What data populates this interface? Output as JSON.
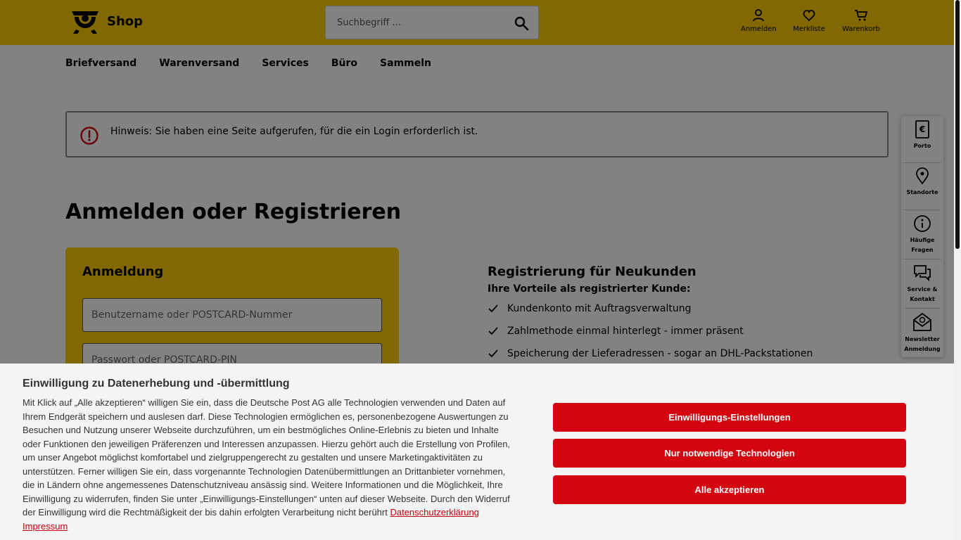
{
  "header": {
    "logo_text": "Shop",
    "search_placeholder": "Suchbegriff ...",
    "actions": [
      {
        "label": "Anmelden",
        "icon": "user-icon"
      },
      {
        "label": "Merkliste",
        "icon": "heart-icon"
      },
      {
        "label": "Warenkorb",
        "icon": "cart-icon"
      }
    ]
  },
  "nav": [
    "Briefversand",
    "Warenversand",
    "Services",
    "Büro",
    "Sammeln"
  ],
  "notice": {
    "text": "Hinweis: Sie haben eine Seite aufgerufen, für die ein Login erforderlich ist.",
    "icon": "alert-icon"
  },
  "page_title": "Anmelden oder Registrieren",
  "login": {
    "title": "Anmeldung",
    "username_placeholder": "Benutzername oder POSTCARD-Nummer",
    "password_placeholder": "Passwort oder POSTCARD-PIN"
  },
  "register": {
    "title": "Registrierung für Neukunden",
    "subtitle": "Ihre Vorteile als registrierter Kunde:",
    "benefits": [
      "Kundenkonto mit Auftragsverwaltung",
      "Zahlmethode einmal hinterlegt - immer präsent",
      "Speicherung der Lieferadressen - sogar an DHL-Packstationen"
    ]
  },
  "side_panel": [
    {
      "label1": "Porto",
      "label2": "",
      "icon": "euro-document-icon"
    },
    {
      "label1": "Standorte",
      "label2": "",
      "icon": "location-pin-icon"
    },
    {
      "label1": "Häufige",
      "label2": "Fragen",
      "icon": "info-icon"
    },
    {
      "label1": "Service &",
      "label2": "Kontakt",
      "icon": "chat-icon"
    },
    {
      "label1": "Newsletter",
      "label2": "Anmeldung",
      "icon": "newsletter-icon"
    }
  ],
  "consent": {
    "title": "Einwilligung zu Datenerhebung und -übermittlung",
    "text": "Mit Klick auf „Alle akzeptieren“ willigen Sie ein, dass die Deutsche Post AG alle Technologien verwenden und Daten auf Ihrem Endgerät speichern und auslesen darf. Diese Technologien ermöglichen es, personenbezogene Auswertungen zu Besuchen und Nutzung unserer Webseite durchzuführen, um ein bestmögliches Online-Erlebnis zu bieten und Inhalte oder Funktionen den jeweiligen Präferenzen und Interessen anzupassen. Hierzu gehört auch die Erstellung von Profilen, um unser Angebot möglichst komfortabel und zielgruppengerecht zu gestalten und unsere Marketingaktivitäten zu unterstützen. Ferner willigen Sie ein, dass vorgenannte Technologien Datenübermittlungen an Drittanbieter vornehmen, die in Ländern ohne angemessenes Datenschutzniveau ansässig sind. Weitere Informationen und die Möglichkeit, Ihre Einwilligung zu widerrufen, finden Sie unter „Einwilligungs-Einstellungen“ unten auf dieser Webseite. Durch den Widerruf der Einwilligung wird die Rechtmäßigkeit der bis dahin erfolgten Verarbeitung nicht berührt",
    "link_privacy": "Datenschutzerklärung",
    "link_imprint": "Impressum",
    "btn_settings": "Einwilligungs-Einstellungen",
    "btn_necessary": "Nur notwendige Technologien",
    "btn_accept": "Alle akzeptieren"
  },
  "colors": {
    "brand_yellow": "#ffcc00",
    "brand_red": "#d40511"
  }
}
